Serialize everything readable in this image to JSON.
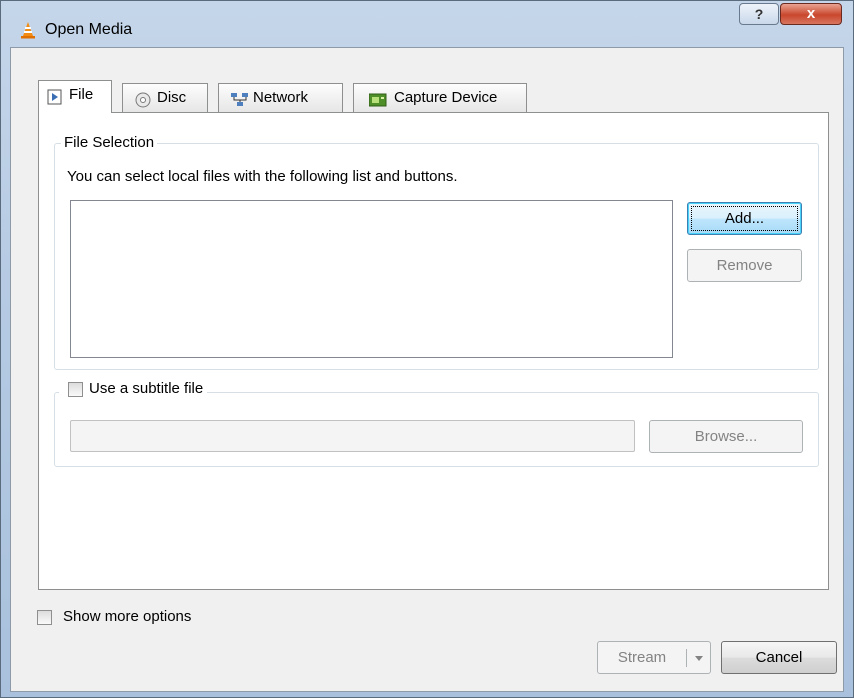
{
  "window": {
    "title": "Open Media",
    "help_label": "?",
    "close_label": "x"
  },
  "tabs": [
    {
      "label": "File",
      "icon": "file-play-icon"
    },
    {
      "label": "Disc",
      "icon": "disc-icon"
    },
    {
      "label": "Network",
      "icon": "network-icon"
    },
    {
      "label": "Capture Device",
      "icon": "capture-device-icon"
    }
  ],
  "file_selection": {
    "group_label": "File Selection",
    "description": "You can select local files with the following list and buttons.",
    "add_label": "Add...",
    "remove_label": "Remove"
  },
  "subtitle": {
    "checkbox_label": "Use a subtitle file",
    "browse_label": "Browse..."
  },
  "footer": {
    "show_more_label": "Show more options",
    "stream_label": "Stream",
    "cancel_label": "Cancel"
  },
  "colors": {
    "accent_blue": "#3c7fb1",
    "close_red": "#c9472d",
    "vlc_orange": "#f28c12"
  }
}
